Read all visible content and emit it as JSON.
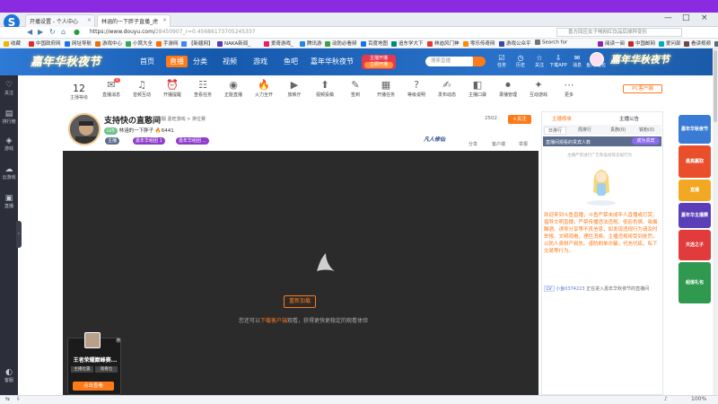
{
  "browser": {
    "tabs": [
      {
        "label": "开播设置 - 个人中心"
      },
      {
        "label": "林涵的一下胖子直播_虎"
      }
    ],
    "url_main": "https://www.douyu.com/",
    "url_path": "28450907_r=0.45686173705245337",
    "search_placeholder": "香方回应女子喝网红饮品后掉秤变形",
    "bookmarks": [
      {
        "label": "收藏",
        "color": "#f4b400"
      },
      {
        "label": "中国政府网",
        "color": "#d93025"
      },
      {
        "label": "网址导航",
        "color": "#1a73e8"
      },
      {
        "label": "游戏中心",
        "color": "#e8710a"
      },
      {
        "label": "小窝大全",
        "color": "#34a853"
      },
      {
        "label": "手游网",
        "color": "#ff6d00"
      },
      {
        "label": "【新疆网】",
        "color": "#4285f4"
      },
      {
        "label": "NAKA新闻_",
        "color": "#5e35b1"
      },
      {
        "label": "爱奇游戏_",
        "color": "#e91e63"
      },
      {
        "label": "腾讯游",
        "color": "#1e88e5"
      },
      {
        "label": "动防必看频",
        "color": "#43a047"
      },
      {
        "label": "百度地图",
        "color": "#1a73e8"
      },
      {
        "label": "追东学大下",
        "color": "#00897b"
      },
      {
        "label": "林迪风门神",
        "color": "#e53935"
      },
      {
        "label": "零乐传奇网",
        "color": "#fb8c00"
      },
      {
        "label": "游戏公众平",
        "color": "#3949ab"
      },
      {
        "label": "Search for",
        "color": "#757575"
      },
      {
        "label": "阅读一阅",
        "color": "#8e24aa"
      },
      {
        "label": "中国邮网",
        "color": "#c62828"
      },
      {
        "label": "爱问部",
        "color": "#00acc1"
      },
      {
        "label": "看读视频",
        "color": "#6d4c41"
      },
      {
        "label": "主播",
        "color": "#546e7a"
      }
    ]
  },
  "douyu_header": {
    "brand": "嘉年华秋夜节",
    "nav": [
      "首页",
      "直播",
      "分类",
      "视频",
      "游戏",
      "鱼吧",
      "嘉年华秋夜节"
    ],
    "active_nav": "直播",
    "live_badge_line1": "主播开播",
    "live_badge_line2": "立即开播",
    "search_placeholder": "搜索直播",
    "icons": [
      {
        "label": "任务",
        "icon": "task-icon"
      },
      {
        "label": "历史",
        "icon": "history-icon"
      },
      {
        "label": "关注",
        "icon": "star-icon"
      },
      {
        "label": "下载APP",
        "icon": "download-icon"
      },
      {
        "label": "消息",
        "icon": "message-icon"
      },
      {
        "label": "鱼丸/钱包",
        "icon": "wallet-icon"
      }
    ]
  },
  "left_sidebar": [
    {
      "label": "关注",
      "icon": "heart-icon"
    },
    {
      "label": "排行榜",
      "icon": "rank-icon"
    },
    {
      "label": "游戏",
      "icon": "gamepad-icon"
    },
    {
      "label": "云游戏",
      "icon": "cloud-icon"
    },
    {
      "label": "直播",
      "icon": "tv-icon"
    },
    {
      "label": "客服",
      "icon": "headset-icon"
    }
  ],
  "toolbar": {
    "level_num": "12",
    "level_label": "主播等级",
    "items": [
      {
        "label": "直播消息",
        "badge": "1"
      },
      {
        "label": "音频互动"
      },
      {
        "label": "开播提醒"
      },
      {
        "label": "查看任务"
      },
      {
        "label": "正能直播"
      },
      {
        "label": "火力全开"
      },
      {
        "label": "放映厅"
      },
      {
        "label": "视频投稿"
      },
      {
        "label": "签到"
      },
      {
        "label": "开播任务"
      },
      {
        "label": "等级说明"
      },
      {
        "label": "发布动态"
      },
      {
        "label": "主播口袋"
      },
      {
        "label": "录播管理"
      },
      {
        "label": "互动游戏"
      },
      {
        "label": "更多"
      }
    ],
    "pc_button": "PC客户端"
  },
  "streamer": {
    "title": "支持快の直憨间",
    "meta": "客服  嘉旺游戏 > 排位赛",
    "name_level": "LV5",
    "name": "林涵的一下胖子",
    "heat": "6441",
    "chip_anchor": "主播",
    "chip_purple1": "嘉年华组团 1",
    "chip_purple2": "嘉年华组团 ...",
    "followers": "2502",
    "follow_label": "+关注",
    "rank_logo": "凡人修仙",
    "actions": [
      "分享",
      "客户端",
      "举报"
    ]
  },
  "player": {
    "refresh_label": "重新加载",
    "msg_prefix": "您还可以",
    "msg_link": "下载客户端",
    "msg_suffix": "观看，获得更快更稳定的观看体验"
  },
  "overlay_card": {
    "title": "王者荣耀巅峰赛...",
    "tags": [
      "主播位置",
      "观看位"
    ],
    "button": "点击查看"
  },
  "right_panel": {
    "top_tabs": [
      "主播榜单",
      "主播公告"
    ],
    "subtabs": [
      "日排行",
      "周排行",
      "贵族(0)",
      "铁粉(0)"
    ],
    "dark_bar_text": "直播间观看的贵宾人数",
    "dark_bar_button": "成为贵宾",
    "hint": "主播严禁进行广告和低俗等违规行为",
    "notice": "欢迎来到斗鱼直播，斗鱼严禁未成年人直播或打赏，倡导文明直播，严禁传播违法违规、低俗色情、吸烟酗酒、诱导分享等不良信息，如发现违规行为请及时举报，文明观看，理性消费。主播违规将受到处罚，以防人身财产损失。谨防刷单诈骗，代充代练，私下交易等行为。",
    "join_user": "小鱼0374223",
    "join_text": "正在进入嘉年华秋夜节的直播间"
  },
  "ads": [
    {
      "label": "嘉年华秋夜节",
      "color": "#3a7bd5"
    },
    {
      "label": "最高赢取",
      "color": "#e94f2b"
    },
    {
      "label": "直播",
      "color": "#f2a822"
    },
    {
      "label": "嘉年华主播赛",
      "color": "#5a3fb8"
    },
    {
      "label": "天选之子",
      "color": "#e23b3b"
    },
    {
      "label": "超值礼包",
      "color": "#2f9a4f"
    }
  ],
  "statusbar": {
    "zoom": "100%"
  }
}
